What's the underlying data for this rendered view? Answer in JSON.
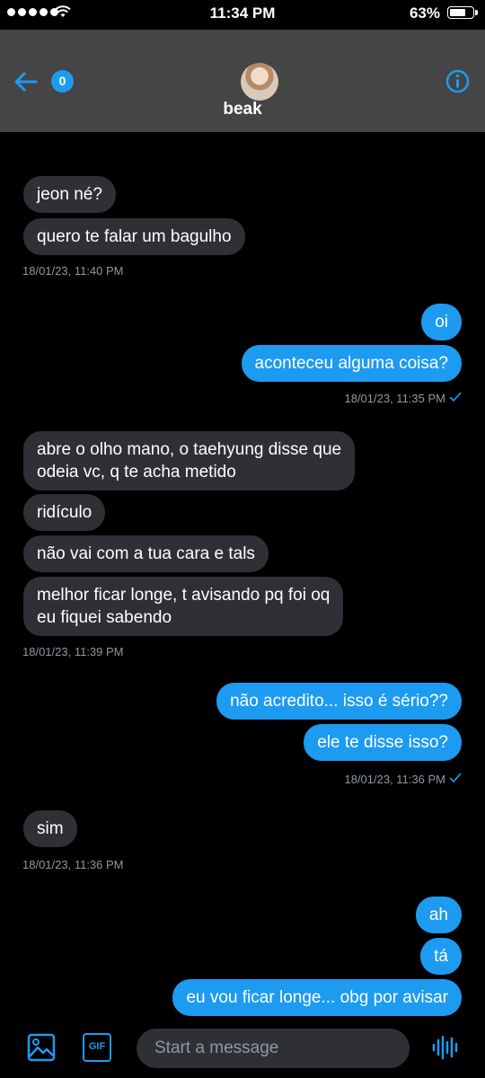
{
  "status_bar": {
    "time": "11:34 PM",
    "battery": "63%"
  },
  "header": {
    "unread_count": "0",
    "contact_name": "beak"
  },
  "messages": [
    {
      "direction": "in",
      "text": "jeon né?"
    },
    {
      "direction": "in",
      "text": "quero te falar um bagulho"
    },
    {
      "direction": "in",
      "timestamp": "18/01/23, 11:40 PM"
    },
    {
      "direction": "out",
      "text": "oi"
    },
    {
      "direction": "out",
      "text": "aconteceu alguma coisa?"
    },
    {
      "direction": "out",
      "timestamp": "18/01/23, 11:35 PM"
    },
    {
      "direction": "in",
      "text": "abre o olho mano, o taehyung disse que\nodeia vc, q te acha metido"
    },
    {
      "direction": "in",
      "text": "ridículo"
    },
    {
      "direction": "in",
      "text": "não vai com a tua cara e tals"
    },
    {
      "direction": "in",
      "text": "melhor ficar longe,  t avisando pq foi oq\neu fiquei sabendo"
    },
    {
      "direction": "in",
      "timestamp": "18/01/23, 11:39 PM"
    },
    {
      "direction": "out",
      "text": "não acredito... isso é sério??"
    },
    {
      "direction": "out",
      "text": "ele te disse isso?"
    },
    {
      "direction": "out",
      "timestamp": "18/01/23, 11:36 PM"
    },
    {
      "direction": "in",
      "text": "sim"
    },
    {
      "direction": "in",
      "timestamp": "18/01/23, 11:36 PM"
    },
    {
      "direction": "out",
      "text": "ah"
    },
    {
      "direction": "out",
      "text": "tá"
    },
    {
      "direction": "out",
      "text": "eu vou ficar longe... obg por avisar"
    }
  ],
  "composer": {
    "placeholder": "Start a message",
    "gif_label": "GIF"
  },
  "colors": {
    "accent": "#1d9bf0",
    "incoming_bubble": "#2f3036",
    "header_bg": "#454545"
  },
  "icons": [
    "back-arrow-icon",
    "info-icon",
    "image-icon",
    "gif-icon",
    "voice-icon",
    "wifi-icon",
    "battery-icon",
    "read-check-icon"
  ]
}
